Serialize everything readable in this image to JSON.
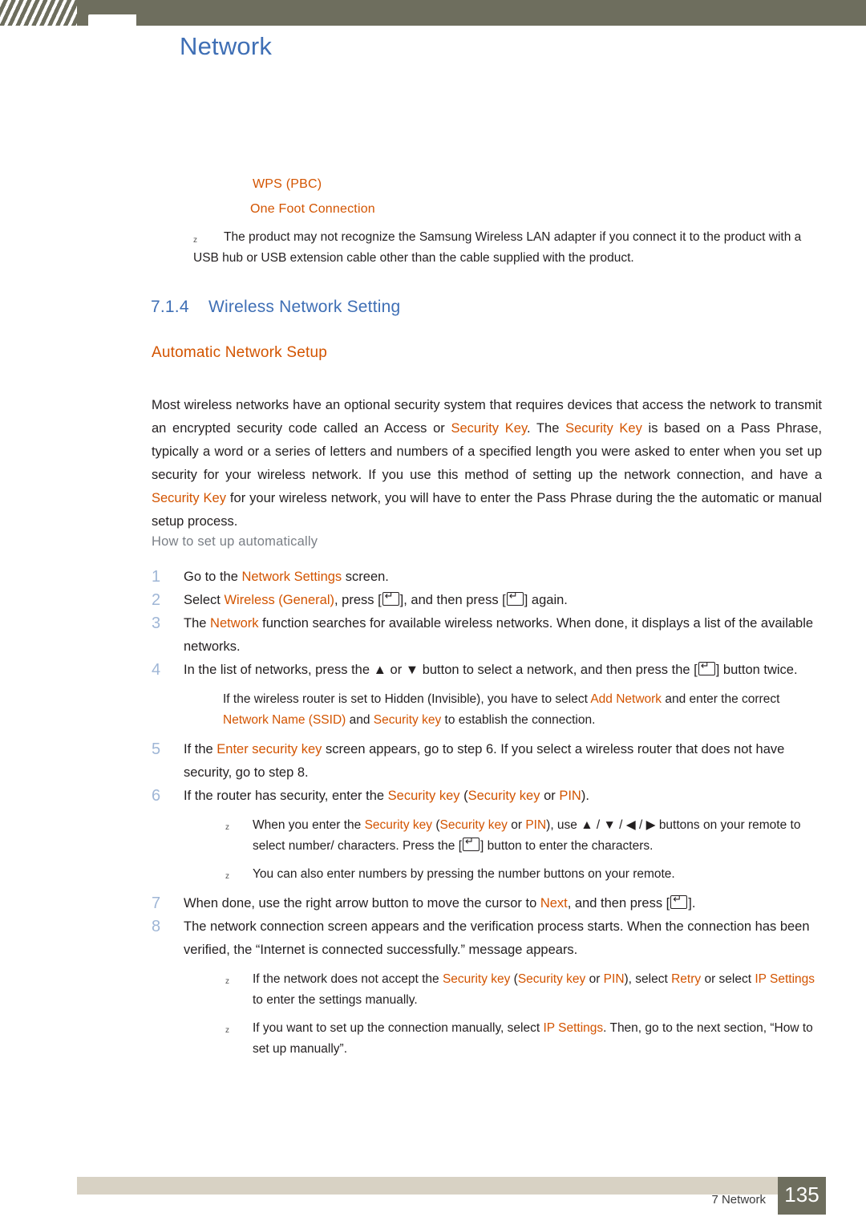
{
  "header": {
    "title": "Network"
  },
  "bullets": {
    "wps": "WPS (PBC)",
    "one_foot": "One Foot Connection"
  },
  "note_top": {
    "marker": "z",
    "text": "The product may not recognize the Samsung Wireless LAN adapter if you connect it to the product with a USB hub or USB extension cable other than the cable supplied with the product."
  },
  "section": {
    "number": "7.1.4",
    "title": "Wireless Network Setting",
    "subtitle": "Automatic Network Setup"
  },
  "paragraph": {
    "p1": "Most wireless networks have an optional security system that requires devices that access the network to transmit an encrypted security code called an Access or ",
    "k1": "Security Key",
    "p2": ". The ",
    "k2": "Security Key",
    "p3": " is based on a Pass Phrase, typically a word or a series of letters and numbers of a specified length you were asked to enter when you set up security for your wireless network. If you use this method of setting up the network connection, and have a ",
    "k3": "Security Key",
    "p4": " for your wireless network, you will have to enter the Pass Phrase during the the automatic or manual setup process."
  },
  "howto_heading": "How to set up automatically",
  "steps": [
    {
      "n": "1",
      "parts": [
        {
          "t": "Go to the "
        },
        {
          "t": "Network Settings",
          "c": "orange"
        },
        {
          "t": " screen."
        }
      ]
    },
    {
      "n": "2",
      "parts": [
        {
          "t": "Select "
        },
        {
          "t": "Wireless (General)",
          "c": "orange"
        },
        {
          "t": ", press ["
        },
        {
          "t": "",
          "icon": "enter-key-icon"
        },
        {
          "t": "], and then press ["
        },
        {
          "t": "",
          "icon": "enter-key-icon"
        },
        {
          "t": "] again."
        }
      ]
    },
    {
      "n": "3",
      "parts": [
        {
          "t": "The "
        },
        {
          "t": "Network",
          "c": "orange"
        },
        {
          "t": " function searches for available wireless networks. When done, it displays a list of the available networks."
        }
      ]
    },
    {
      "n": "4",
      "parts": [
        {
          "t": "In the list of networks, press the ▲ or ▼ button to select a network, and then press the ["
        },
        {
          "t": "",
          "icon": "enter-key-icon"
        },
        {
          "t": "] button twice."
        }
      ]
    },
    {
      "n": "5",
      "parts": [
        {
          "t": "If the "
        },
        {
          "t": "Enter security key",
          "c": "orange"
        },
        {
          "t": " screen appears, go to step 6. If you select a wireless router that does not have security, go to step 8."
        }
      ]
    },
    {
      "n": "6",
      "parts": [
        {
          "t": "If the router has security, enter the "
        },
        {
          "t": "Security key",
          "c": "orange"
        },
        {
          "t": " ("
        },
        {
          "t": "Security key",
          "c": "orange"
        },
        {
          "t": " or "
        },
        {
          "t": "PIN",
          "c": "orange"
        },
        {
          "t": ")."
        }
      ]
    },
    {
      "n": "7",
      "parts": [
        {
          "t": "When done, use the right arrow button to move the cursor to "
        },
        {
          "t": "Next",
          "c": "orange"
        },
        {
          "t": ", and then press ["
        },
        {
          "t": "",
          "icon": "enter-key-icon"
        },
        {
          "t": "]."
        }
      ]
    },
    {
      "n": "8",
      "parts": [
        {
          "t": "The network connection screen appears and the verification process starts. When the connection has been verified, the “Internet is connected successfully.” message appears."
        }
      ]
    }
  ],
  "subnotes": {
    "after4": {
      "line1_a": "If the wireless router is set to Hidden (Invisible), you have to select ",
      "line1_k": "Add Network",
      "line1_b": " and enter the correct ",
      "line2_k1": "Network Name (SSID)",
      "line2_mid": " and ",
      "line2_k2": "Security key",
      "line2_end": " to establish the connection."
    },
    "after6a": {
      "marker": "z",
      "a": "When you enter the ",
      "k1": "Security key",
      "b": " (",
      "k2": "Security key",
      "c": " or ",
      "k3": "PIN",
      "d": "), use ▲ / ▼ / ◀ / ▶ buttons on your remote to select number/ characters. Press the [",
      "e": "] button to enter the characters."
    },
    "after6b": {
      "marker": "z",
      "text": "You can also enter numbers by pressing the number buttons on your remote."
    },
    "after8a": {
      "marker": "z",
      "a": "If the network does not accept the ",
      "k1": "Security key",
      "b": " (",
      "k2": "Security key",
      "c": " or ",
      "k3": "PIN",
      "d": "), select ",
      "k4": "Retry",
      "e": " or select ",
      "k5": "IP Settings",
      "f": " to enter the settings manually."
    },
    "after8b": {
      "marker": "z",
      "a": "If you want to set up the connection manually, select ",
      "k1": "IP Settings",
      "b": ". Then, go to the next section, “How to set up manually”."
    }
  },
  "footer": {
    "chapter": "7 Network",
    "page": "135"
  },
  "colors": {
    "header_bar": "#6e6e5e",
    "blue": "#3f6fb5",
    "orange": "#d35400",
    "footer_rule": "#d8d2c4"
  }
}
